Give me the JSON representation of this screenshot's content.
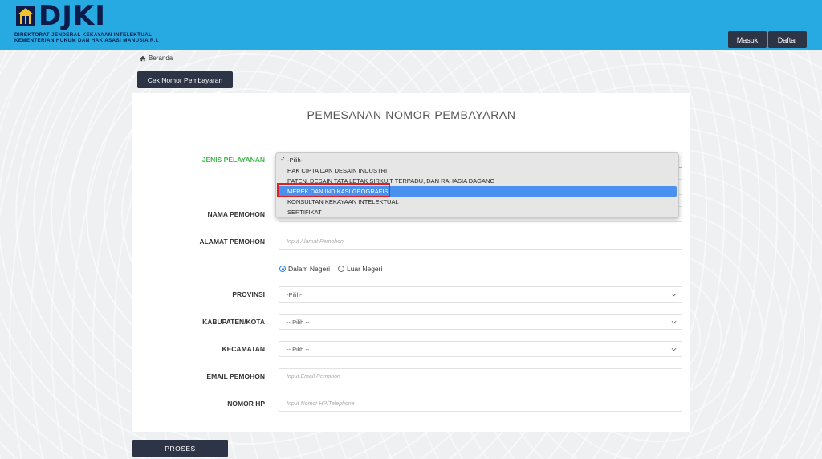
{
  "header": {
    "logo_word": "DJKI",
    "logo_line1": "DIREKTORAT JENDERAL KEKAYAAN INTELEKTUAL",
    "logo_line2": "KEMENTERIAN HUKUM DAN HAK ASASI MANUSIA R.I.",
    "masuk_label": "Masuk",
    "daftar_label": "Daftar"
  },
  "breadcrumb": {
    "home_label": "Beranda"
  },
  "cek_button_label": "Cek Nomor Pembayaran",
  "card": {
    "title": "PEMESANAN NOMOR PEMBAYARAN"
  },
  "form": {
    "jenis_label": "JENIS PELAYANAN",
    "nama_label": "NAMA PEMOHON",
    "alamat_label": "ALAMAT PEMOHON",
    "alamat_placeholder": "Input Alamat Pemohon",
    "radio_dalam": "Dalam Negeri",
    "radio_luar": "Luar Negeri",
    "provinsi_label": "PROVINSI",
    "provinsi_value": "-Pilih-",
    "kabupaten_label": "KABUPATEN/KOTA",
    "kabupaten_value": "-- Pilih --",
    "kecamatan_label": "KECAMATAN",
    "kecamatan_value": "-- Pilih --",
    "email_label": "EMAIL PEMOHON",
    "email_placeholder": "Input Email Pemohon",
    "hp_label": "NOMOR HP",
    "hp_placeholder": "Input Nomor HP/Telephone"
  },
  "dropdown": {
    "options": [
      "-Pilih-",
      "HAK CIPTA DAN DESAIN INDUSTRI",
      "PATEN, DESAIN TATA LETAK SIRKUIT TERPADU, DAN RAHASIA DAGANG",
      "MEREK DAN INDIKASI GEOGRAFIS",
      "KONSULTAN KEKAYAAN INTELEKTUAL",
      "SERTIFIKAT"
    ],
    "check_mark": "✓"
  },
  "proses_label": "PROSES",
  "colors": {
    "header_bg": "#27a9e1",
    "button_dark": "#2d3446",
    "label_green": "#3fb94a",
    "highlight_red": "#e02020",
    "selected_blue": "#4a90ee"
  }
}
